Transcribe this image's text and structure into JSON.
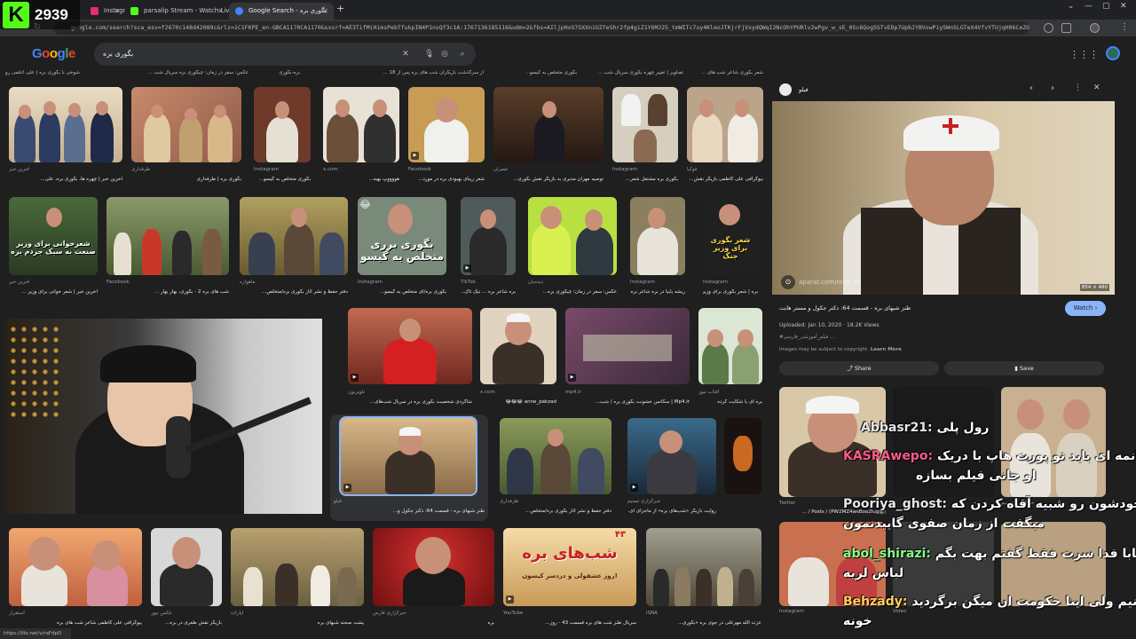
{
  "browser": {
    "tabs": [
      {
        "label": "Instagram",
        "color": "#e1306c"
      },
      {
        "label": "parsalip Stream - Watch Live on",
        "color": "#53fc18"
      },
      {
        "label": "Google Search - بگوری بره",
        "color": "#4285f4"
      }
    ],
    "url": "google.com/search?sca_esv=f2670c148d42089c&rlz=1C1FKPE_en-GBCA1170CA1170&sxsrf=AE3TifMiHimsPebTfukpIN4P1nsQf3c1A:1767136185116&udm=2&fbs=AIljpHxU7SXXniUZfeShr2fp4giZ1Y6MJ25_tmWITc7uy4KleoJTKjrFjVxydQWqI2NcOhYPURlv2wPgv_w_sE_0Sc6Qog5STvEDp7UpbJYBVowPiySWnSLGTeX4VfvYTUjqH06CeZOiZmlisIImXys"
  },
  "kick": {
    "viewers": "2939"
  },
  "search": {
    "query": "بگوری بره",
    "logo": "Google"
  },
  "captions_row0": [
    "شوخی با بگوری بره | علی اعلمی رو ترجم...",
    "عکس: سفر در زمان: چیگوری بره سریال شب ...",
    "بره-بگوری",
    "از سرگذشت بازیگران شب های بره پس از 18 ...",
    "بگوری متخلص به کیسو...",
    "تصاویر | تغییر چهره بگوری سریال شب ...",
    "شعر بگوری شاعر شب های ..."
  ],
  "row1": [
    {
      "src": "آخرین خبر",
      "title": "آخرین خبر | چهره ها، بگوری بره، علی..."
    },
    {
      "src": "طرفداری",
      "title": "بگوری بره | طرفداری"
    },
    {
      "src": "Instagram",
      "title": "بگوری متخلص به گیسو..."
    },
    {
      "src": "x.com",
      "title": "هووووپ بهبه..."
    },
    {
      "src": "Facebook",
      "title": "شعر زیبای بهبودی بره در مورد..."
    },
    {
      "src": "عصران",
      "title": "توصیه مهران مدیری به بازیگر نقش بگوری..."
    },
    {
      "src": "Instagram",
      "title": "بگوری بره مشتعل شعر..."
    },
    {
      "src": "فوکیا",
      "title": "بیوگرافی علی کاظمی بازیگر نقش..."
    }
  ],
  "row2": [
    {
      "src": "آخرین خبر",
      "title": "آخرین خبر | شعر خوانی برای وزیر ...",
      "overlay": "شعرخوانی برای وزیر صنعت به سبک جردم بره"
    },
    {
      "src": "Facebook",
      "title": "شب های بره 2 - بگوری، بهار بهار ...",
      "overlay": ""
    },
    {
      "src": "ماهواره",
      "title": "دفتر حفظ و نشر آثار بگوری بره/متخلص...",
      "overlay": ""
    },
    {
      "src": "Instagram",
      "title": "بگوری بره/ای متخلص به گیسو...",
      "overlay": "بگوری برری متخلص به گیسو"
    },
    {
      "src": "TikTok",
      "title": "بره شاعر بره ... تیک تاک...",
      "overlay": ""
    },
    {
      "src": "دیده‌بان",
      "title": "عکس: سفر در زمان؛ چیگوری بره...",
      "overlay": ""
    },
    {
      "src": "Instagram",
      "title": "ریشه یابیا در بره شاعر بره...",
      "overlay": ""
    },
    {
      "src": "Instagram",
      "title": "بره | شعر بگوری برای وزیر جنگ",
      "overlay": "شعر بگوری برای وزیر جنگ"
    }
  ],
  "row3": [
    {
      "src": "تلویزیون",
      "title": "شاگردی شخصیت بگوری بره در سریال شب‌های..."
    },
    {
      "src": "x.com",
      "title": "anne_pakzad 😂😂😂"
    },
    {
      "src": "mp4.ir",
      "title": "Mp4.ir | سکانس خشونت بگوری بره / شب..."
    },
    {
      "src": "آفتاب نیوز",
      "title": "بره ای با شکایت کرده"
    }
  ],
  "row4": [
    {
      "src": "فیلو",
      "title": "طنز شبهای بره - قسمت 64: دکتر جکول و..."
    },
    {
      "src": "طرفداری",
      "title": "دفتر حفظ و نشر آثار بگوری بره/متخلص..."
    },
    {
      "src": "خبرگزاری تسنیم",
      "title": "روایت بازیگر «شب‌های بره» از ماجرای ای..."
    }
  ],
  "row5": [
    {
      "src": "استقرار",
      "title": "بیوگرافی علی کاظمی شاعر شب های بره"
    },
    {
      "src": "عکس نیوز",
      "title": "بازیگر نقش طعری در بره..."
    },
    {
      "src": "آپارات",
      "title": "پشت صحنه شبهای بره"
    },
    {
      "src": "خبرگزاری فارس",
      "title": "بره"
    },
    {
      "src": "YouTube",
      "title": "سریال طنز شب های بره قسمت 43 - روز..."
    },
    {
      "src": "ISNA",
      "title": "عزت الله مهرعلی در جوی بره «بگوری..."
    }
  ],
  "row5_overlay": {
    "poster": "شب‌های بره",
    "poster_sub": "روز عشقولی و دردسر کیسون!",
    "poster_num": "۴۳"
  },
  "panel": {
    "source": "فیلو",
    "title": "طنز شبهای بره - قسمت 64: دکتر جکول و مستر هایت",
    "watch": "Watch",
    "meta": "Uploaded: Jan 10, 2020 · 18.2K Views",
    "sub": "#فیلم_آموزشی_فارسی ...",
    "copy": "Images may be subject to copyright.",
    "learn": "Learn More",
    "share": "Share",
    "save": "Save",
    "watermark": "aparat.com/reza_31",
    "size": "854 × 480",
    "related": [
      {
        "src": "Twitter",
        "title": "(@PW2MZ4wsBoo2lug) / Posts / ..."
      },
      {
        "src": "Instagram",
        "title": "..."
      },
      {
        "src": "خبرگزاری تسنیم",
        "title": "دکلت بازیگر سریال جشن‌های بره..."
      },
      {
        "src": "Video",
        "title": "..."
      }
    ]
  },
  "chat": [
    {
      "user": "Abbasr21:",
      "msg": "رول پلی"
    },
    {
      "user": "KASRAwepo:",
      "msg": "خوانمه ای باید تو پورت هاپ با دریک"
    },
    {
      "user": "",
      "msg": "او جانی فیلم بسازه"
    },
    {
      "user": "Pooriya_ghost:",
      "msg": "خودشون رو شبیه آقاه کردن که"
    },
    {
      "user": "",
      "msg": "میگفت از زمان صفوی گاییدنمون"
    },
    {
      "user": "abol_shirazi:",
      "msg": "نهههه بابا فدا سرت فقط گفتم بهت بگم"
    },
    {
      "user": "",
      "msg": "لباس لریه"
    },
    {
      "user": "Behzady:",
      "msg": "میدونیم ولی اینا حکومت ان میگن برگردید"
    },
    {
      "user": "",
      "msg": "خونه"
    }
  ],
  "statusbar": "https://lilo.net/v/raFdpD",
  "colors": {
    "kick": "#53fc18",
    "watch": "#8ab4f8",
    "selected": "#8ab4f8"
  }
}
